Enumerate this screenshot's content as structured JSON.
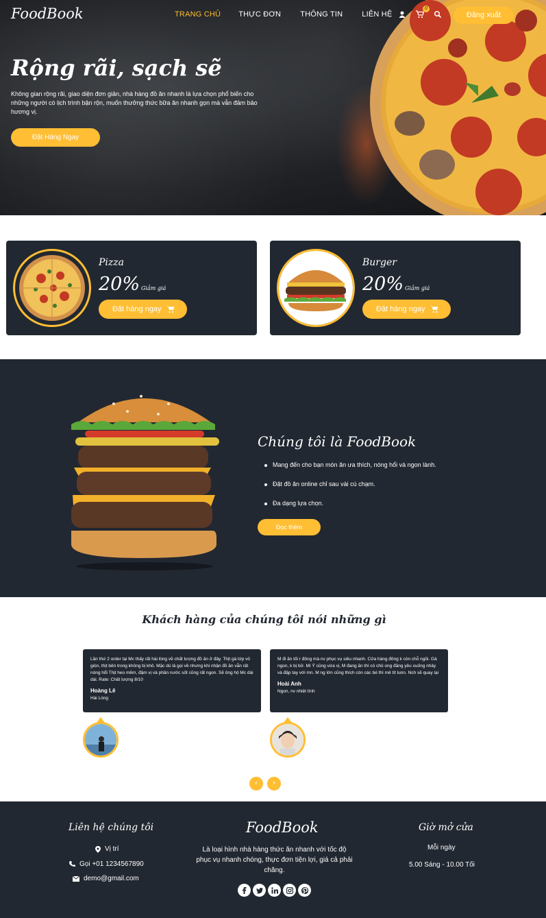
{
  "colors": {
    "accent": "#ffbe33",
    "dark": "#222831",
    "white": "#ffffff"
  },
  "header": {
    "logo": "FoodBook",
    "nav": [
      "TRANG CHỦ",
      "THỰC ĐƠN",
      "THÔNG TIN",
      "LIÊN HỆ"
    ],
    "cart_count": "0",
    "icons": [
      "user-icon",
      "cart-icon",
      "search-icon"
    ],
    "logout_label": "Đăng xuất"
  },
  "hero": {
    "title": "Rộng rãi, sạch sẽ",
    "description": "Không gian rộng rãi, giao diện đơn giản, nhà hàng đồ ăn nhanh là lựa chọn phổ biến cho những người có lịch trình bận rộn, muốn thưởng thức bữa ăn nhanh gọn mà vẫn đảm bảo hương vị.",
    "button": "Đặt Hàng Ngay"
  },
  "offers": [
    {
      "name": "Pizza",
      "percent": "20%",
      "discount_label": "Giảm giá",
      "button": "Đặt hàng ngay"
    },
    {
      "name": "Burger",
      "percent": "20%",
      "discount_label": "Giảm giá",
      "button": "Đặt hàng ngay"
    }
  ],
  "about": {
    "title": "Chúng tôi là FoodBook",
    "points": [
      "Mang đến cho bạn món ăn ưa thích, nóng hổi và ngon lành.",
      "Đặt đồ ăn online chỉ sau vài cú chạm.",
      "Đa dạng lựa chọn."
    ],
    "button": "Đọc thêm"
  },
  "testimonials": {
    "title": "Khách hàng của chúng tôi nói những gì",
    "items": [
      {
        "text": "Lần thứ 2 order tại Mc thấy rất hài lòng về chất lượng đồ ăn ở đây. Thịt gà lớp vỏ giòn, thịt bên trong không bị khô. Mặc dù là gọi về nhưng khi nhận đồ ăn vẫn rất nóng hổi Thịt heo mềm, đậm vị và phần nước sốt cũng rất ngon. Sẽ ủng hộ Mc dài dài. Rate: Chất lượng 8/10",
        "name": "Hoàng Lê",
        "role": "Hài Lòng"
      },
      {
        "text": "M đi ăn tối r đông mà nv phục vụ siêu nhanh. Cửa hàng đông k còn chỗ ngồi. Gà ngon, k bị bở. Mì Ý cũng vừa vị, M đang ăn thì có chủ ong đăng yêu xuống nhảy và đập tay với mn. M ng lớn cũng thích còn các bé thì mê tít lunn. Nch sẽ quay lại",
        "name": "Hoài Anh",
        "role": "Ngon, nv nhiệt tình"
      }
    ],
    "prev": "‹",
    "next": "›"
  },
  "footer": {
    "contact_title": "Liên hệ chúng tôi",
    "location": "Vị trí",
    "phone": "Gọi +01 1234567890",
    "email": "demo@gmail.com",
    "brand": "FoodBook",
    "description": "Là loại hình nhà hàng thức ăn nhanh với tốc độ phục vụ nhanh chóng, thực đơn tiện lợi, giá cả phải chăng.",
    "socials": [
      "facebook-icon",
      "twitter-icon",
      "linkedin-icon",
      "instagram-icon",
      "pinterest-icon"
    ],
    "hours_title": "Giờ mở cửa",
    "hours_days": "Mỗi ngày",
    "hours_time": "5.00 Sáng - 10.00 Tối"
  }
}
